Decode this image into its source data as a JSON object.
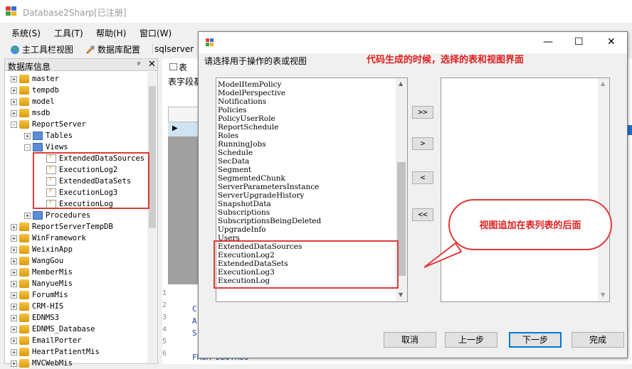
{
  "window": {
    "title": "Database2Sharp[已注册]"
  },
  "menu": [
    {
      "label": "系统(S)"
    },
    {
      "label": "工具(T)"
    },
    {
      "label": "帮助(H)"
    },
    {
      "label": "窗口(W)"
    }
  ],
  "toolbar": [
    {
      "label": "主工具栏视图",
      "icon": "globe-icon"
    },
    {
      "label": "数据库配置",
      "icon": "tools-icon"
    },
    {
      "label": "sqlserver",
      "icon": ""
    }
  ],
  "panel": {
    "title": "数据库信息",
    "pin": "ᵖ",
    "close": "✕"
  },
  "tree": [
    {
      "label": "master",
      "icon": "db-icon",
      "exp": "+"
    },
    {
      "label": "tempdb",
      "icon": "db-icon",
      "exp": "+"
    },
    {
      "label": "model",
      "icon": "db-icon",
      "exp": "+"
    },
    {
      "label": "msdb",
      "icon": "db-icon",
      "exp": "+"
    },
    {
      "label": "ReportServer",
      "icon": "db-icon",
      "exp": "-"
    },
    {
      "label": "Tables",
      "icon": "folder-icon",
      "exp": "+"
    },
    {
      "label": "Views",
      "icon": "folder-icon",
      "exp": "-"
    },
    {
      "label": "ExtendedDataSources",
      "icon": "view-icon",
      "exp": ""
    },
    {
      "label": "ExecutionLog2",
      "icon": "view-icon",
      "exp": ""
    },
    {
      "label": "ExtendedDataSets",
      "icon": "view-icon",
      "exp": ""
    },
    {
      "label": "ExecutionLog3",
      "icon": "view-icon",
      "exp": ""
    },
    {
      "label": "ExecutionLog",
      "icon": "view-icon",
      "exp": ""
    },
    {
      "label": "Procedures",
      "icon": "folder-icon",
      "exp": "+"
    },
    {
      "label": "ReportServerTempDB",
      "icon": "db-icon",
      "exp": "+"
    },
    {
      "label": "WinFramework",
      "icon": "db-icon",
      "exp": "+"
    },
    {
      "label": "WeixinApp",
      "icon": "db-icon",
      "exp": "+"
    },
    {
      "label": "WangGou",
      "icon": "db-icon",
      "exp": "+"
    },
    {
      "label": "MemberMis",
      "icon": "db-icon",
      "exp": "+"
    },
    {
      "label": "NanyueMis",
      "icon": "db-icon",
      "exp": "+"
    },
    {
      "label": "ForumMis",
      "icon": "db-icon",
      "exp": "+"
    },
    {
      "label": "CRM-HIS",
      "icon": "db-icon",
      "exp": "+"
    },
    {
      "label": "EDNMS3",
      "icon": "db-icon",
      "exp": "+"
    },
    {
      "label": "EDNMS_Database",
      "icon": "db-icon",
      "exp": "+"
    },
    {
      "label": "EmailPorter",
      "icon": "db-icon",
      "exp": "+"
    },
    {
      "label": "HeartPatientMis",
      "icon": "db-icon",
      "exp": "+"
    },
    {
      "label": "MVCWebMis",
      "icon": "db-icon",
      "exp": "+"
    }
  ],
  "doc": {
    "tab_label": "表",
    "field_label": "表字段基",
    "gutter": [
      "1",
      "2",
      "3",
      "4",
      "5",
      "6"
    ],
    "code": [
      "C",
      "A",
      "S",
      "",
      "FROM DBO.ROS"
    ]
  },
  "dialog": {
    "instruction": "请选择用于操作的表或视图",
    "annotation": "代码生成的时候，选择的表和视图界面",
    "left_items": [
      "ModelItemPolicy",
      "ModelPerspective",
      "Notifications",
      "Policies",
      "PolicyUserRole",
      "ReportSchedule",
      "Roles",
      "RunningJobs",
      "Schedule",
      "SecData",
      "Segment",
      "SegmentedChunk",
      "ServerParametersInstance",
      "ServerUpgradeHistory",
      "SnapshotData",
      "Subscriptions",
      "SubscriptionsBeingDeleted",
      "UpgradeInfo",
      "Users",
      "ExtendedDataSources",
      "ExecutionLog2",
      "ExtendedDataSets",
      "ExecutionLog3",
      "ExecutionLog"
    ],
    "move_buttons": [
      ">>",
      ">",
      "<",
      "<<"
    ],
    "nav": {
      "cancel": "取消",
      "prev": "上一步",
      "next": "下一步",
      "finish": "完成"
    }
  },
  "callout": {
    "text": "视图追加在表列表的后面"
  },
  "colors": {
    "annotation_red": "#e02020",
    "focus_blue": "#0078d7"
  }
}
